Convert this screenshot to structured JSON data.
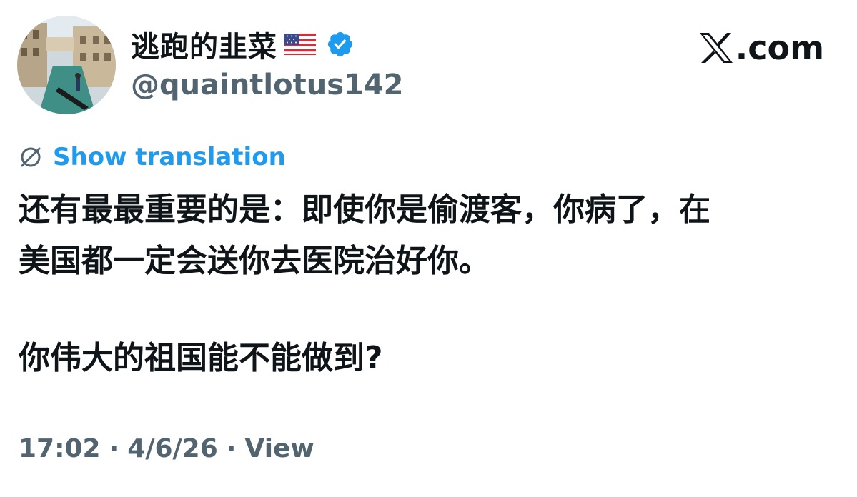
{
  "author": {
    "display_name": "逃跑的韭菜",
    "flag_icon": "us-flag-icon",
    "verified_icon": "verified-badge-icon",
    "handle": "@quaintlotus142"
  },
  "brand": {
    "logo_icon": "x-logo-icon",
    "text": ".com"
  },
  "translation": {
    "icon": "globe-slash-icon",
    "label": "Show translation"
  },
  "tweet": {
    "line1": "还有最最重要的是：即使你是偷渡客，你病了，在",
    "line2": "美国都一定会送你去医院治好你。",
    "line3": "你伟大的祖国能不能做到?"
  },
  "meta": {
    "time": "17:02",
    "sep1": "·",
    "date": "4/6/26",
    "sep2": "·",
    "view": "View"
  },
  "colors": {
    "accent": "#1d9bf0",
    "secondary_text": "#536471",
    "primary_text": "#0f1419"
  }
}
